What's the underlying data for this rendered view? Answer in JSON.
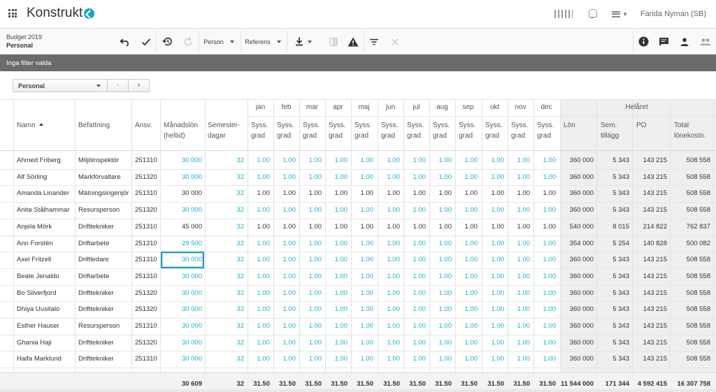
{
  "app": {
    "brand": "Konstrukt",
    "user": "Farida Nyman (SB)"
  },
  "breadcrumb": {
    "line1": "Budget 2019",
    "line2": "Personal"
  },
  "toolbar": {
    "person_label": "Person",
    "referens_label": "Referens"
  },
  "filter": {
    "text": "Inga filter valda"
  },
  "selector": {
    "value": "Personal",
    "prev": "‹",
    "next": "›"
  },
  "headers": {
    "name": "Namn",
    "title": "Befattning",
    "ansv": "Ansv.",
    "salary_l1": "Månadslön",
    "salary_l2": "(heltid)",
    "vac_l1": "Semester-",
    "vac_l2": "dagar",
    "syss_l1": "Syss.",
    "syss_l2": "grad",
    "year_group": "Helåret",
    "lon": "Lön",
    "semtill_l1": "Sem.",
    "semtill_l2": "tillägg",
    "po": "PO",
    "total_l1": "Total",
    "total_l2": "lönekostn."
  },
  "months": [
    "jan",
    "feb",
    "mar",
    "apr",
    "maj",
    "jun",
    "jul",
    "aug",
    "sep",
    "okt",
    "nov",
    "dec"
  ],
  "rows": [
    {
      "name": "Ahmed Friberg",
      "title": "Miljöinspektör",
      "ansv": "251310",
      "salary": "30 000",
      "vac": "32",
      "syss": "1.00",
      "lon": "360 000",
      "semtill": "5 343",
      "po": "143 215",
      "total": "508 558",
      "blue": true
    },
    {
      "name": "Alf Sörling",
      "title": "Markförvaltare",
      "ansv": "251320",
      "salary": "30 000",
      "vac": "32",
      "syss": "1.00",
      "lon": "360 000",
      "semtill": "5 343",
      "po": "143 215",
      "total": "508 558",
      "blue": true
    },
    {
      "name": "Amanda Linander",
      "title": "Mätningsingenjör",
      "ansv": "251310",
      "salary": "30 000",
      "vac": "32",
      "syss": "1.00",
      "lon": "360 000",
      "semtill": "5 343",
      "po": "143 215",
      "total": "508 558",
      "blue": false
    },
    {
      "name": "Anita Stålhammar",
      "title": "Resursperson",
      "ansv": "251320",
      "salary": "30 000",
      "vac": "32",
      "syss": "1.00",
      "lon": "360 000",
      "semtill": "5 343",
      "po": "143 215",
      "total": "508 558",
      "blue": true
    },
    {
      "name": "Anjela Mörk",
      "title": "Drifttekniker",
      "ansv": "251310",
      "salary": "45 000",
      "vac": "32",
      "syss": "1.00",
      "lon": "540 000",
      "semtill": "8 015",
      "po": "214 822",
      "total": "762 837",
      "blue": false
    },
    {
      "name": "Ann Forstén",
      "title": "Driftarbete",
      "ansv": "251310",
      "salary": "29 500",
      "vac": "32",
      "syss": "1.00",
      "lon": "354 000",
      "semtill": "5 254",
      "po": "140 828",
      "total": "500 082",
      "blue": true
    },
    {
      "name": "Axel Fritzell",
      "title": "Driftledare",
      "ansv": "251310",
      "salary": "30 000",
      "vac": "32",
      "syss": "1.00",
      "lon": "360 000",
      "semtill": "5 343",
      "po": "143 215",
      "total": "508 558",
      "blue": true
    },
    {
      "name": "Beate Jenaldo",
      "title": "Driftarbete",
      "ansv": "251310",
      "salary": "30 000",
      "vac": "32",
      "syss": "1.00",
      "lon": "360 000",
      "semtill": "5 343",
      "po": "143 215",
      "total": "508 558",
      "blue": true
    },
    {
      "name": "Bo Silverfjord",
      "title": "Drifttekniker",
      "ansv": "251320",
      "salary": "30 000",
      "vac": "32",
      "syss": "1.00",
      "lon": "360 000",
      "semtill": "5 343",
      "po": "143 215",
      "total": "508 558",
      "blue": true
    },
    {
      "name": "Dhiya Uusitalo",
      "title": "Drifttekniker",
      "ansv": "251320",
      "salary": "30 000",
      "vac": "32",
      "syss": "1.00",
      "lon": "360 000",
      "semtill": "5 343",
      "po": "143 215",
      "total": "508 558",
      "blue": true
    },
    {
      "name": "Esther Hauser",
      "title": "Resursperson",
      "ansv": "251310",
      "salary": "30 000",
      "vac": "32",
      "syss": "1.00",
      "lon": "360 000",
      "semtill": "5 343",
      "po": "143 215",
      "total": "508 558",
      "blue": true
    },
    {
      "name": "Ghania Haji",
      "title": "Drifttekniker",
      "ansv": "251320",
      "salary": "30 000",
      "vac": "32",
      "syss": "1.00",
      "lon": "360 000",
      "semtill": "5 343",
      "po": "143 215",
      "total": "508 558",
      "blue": true
    },
    {
      "name": "Haifa Marklund",
      "title": "Drifttekniker",
      "ansv": "251310",
      "salary": "30 000",
      "vac": "32",
      "syss": "1.00",
      "lon": "360 000",
      "semtill": "5 343",
      "po": "143 215",
      "total": "508 558",
      "blue": true
    }
  ],
  "totals": {
    "salary": "30 609",
    "vac": "32",
    "syss": "31.50",
    "lon": "11 544 000",
    "semtill": "171 344",
    "po": "4 592 415",
    "total": "16 307 758"
  },
  "colors": {
    "accent": "#1ab1d3",
    "filterbar": "#6b6b6b"
  }
}
